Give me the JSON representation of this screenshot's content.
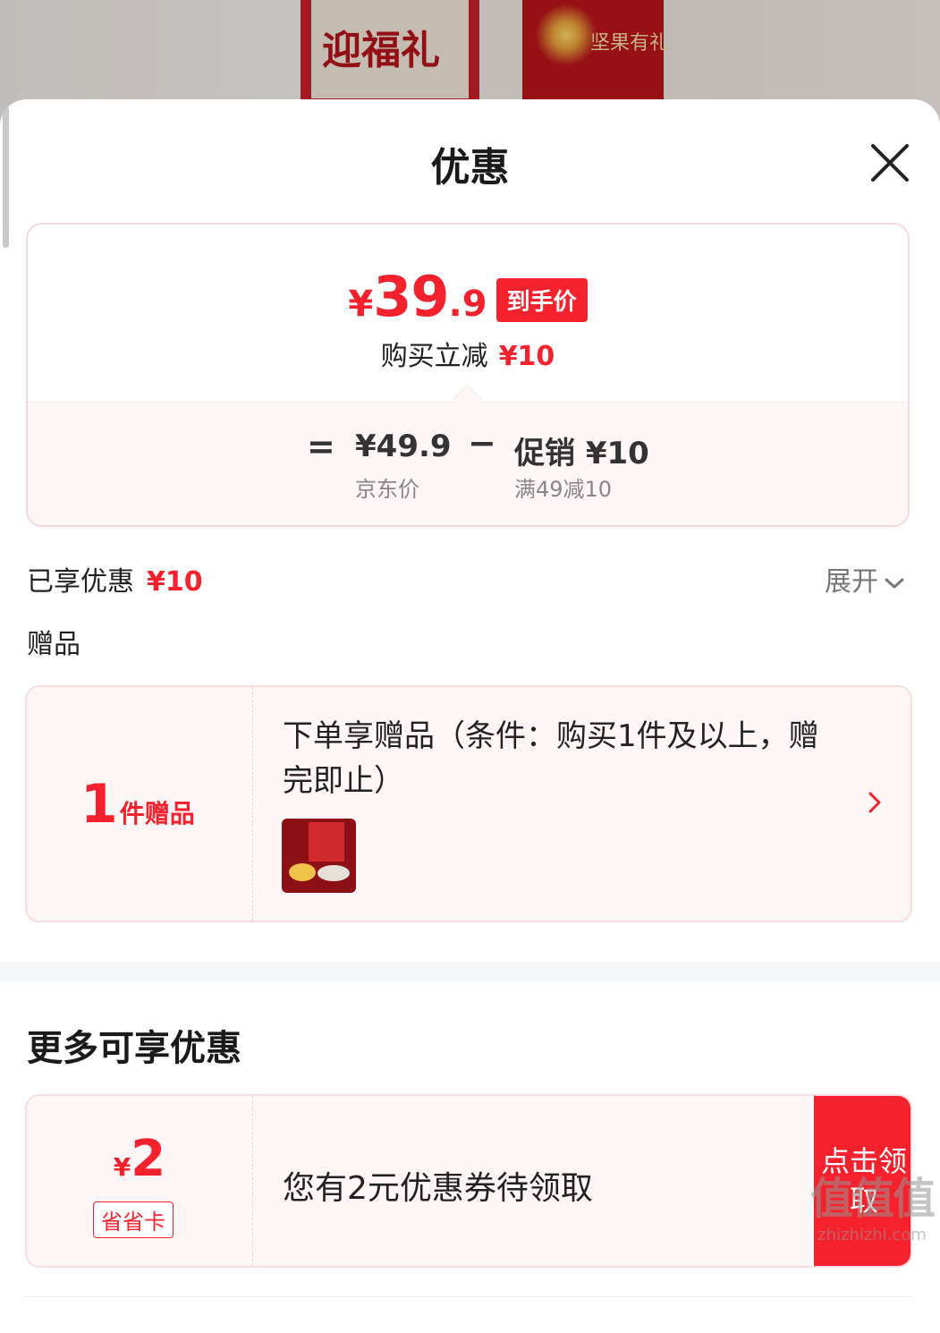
{
  "background": {
    "box1_text": "迎福礼",
    "box2_text": "坚果有礼"
  },
  "sheet": {
    "title": "优惠"
  },
  "price_card": {
    "currency": "¥",
    "price_int": "39",
    "price_dec": ".9",
    "price_tag": "到手价",
    "reduce_label": "购买立减",
    "reduce_amount": "¥10",
    "equals": "=",
    "minus": "−",
    "jd_price": "¥49.9",
    "jd_price_label": "京东价",
    "promo_value": "促销 ¥10",
    "promo_label": "满49减10"
  },
  "enjoyed": {
    "label": "已享优惠",
    "amount": "¥10",
    "expand_label": "展开"
  },
  "gift": {
    "section_label": "赠品",
    "count": "1",
    "count_unit": "件赠品",
    "description": "下单享赠品（条件：购买1件及以上，赠完即止）"
  },
  "more": {
    "title": "更多可享优惠",
    "coupon_currency": "¥",
    "coupon_amount": "2",
    "coupon_badge": "省省卡",
    "coupon_desc": "您有2元优惠券待领取",
    "coupon_button": "点击领取"
  },
  "watermark": {
    "big": "值值值",
    "small": "zhizhizhi.com"
  },
  "colors": {
    "accent": "#f5222d",
    "card_bg": "#fff6f7",
    "card_border": "#f9dde1"
  }
}
